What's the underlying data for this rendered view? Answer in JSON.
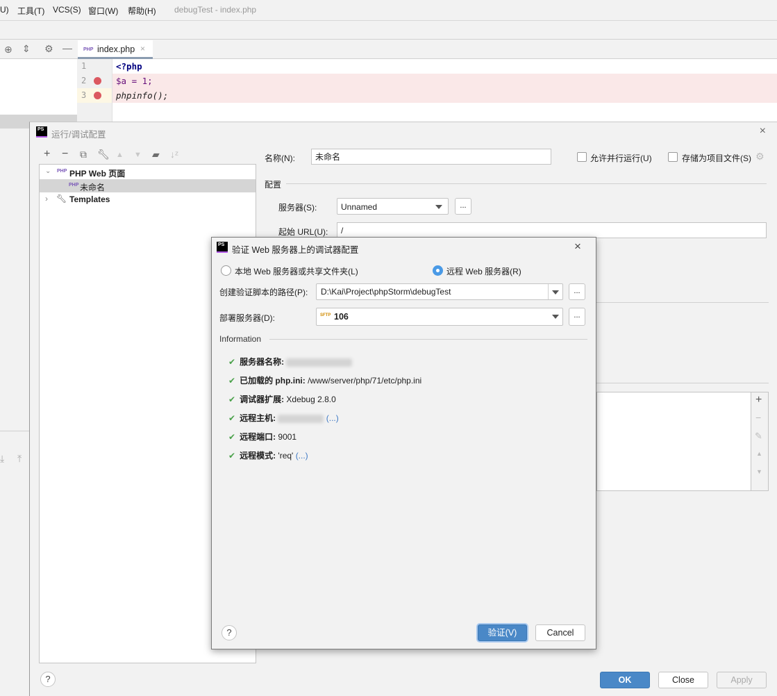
{
  "menu": {
    "items": [
      "U)",
      "工具(T)",
      "VCS(S)",
      "窗口(W)",
      "帮助(H)"
    ],
    "window_title": "debugTest - index.php"
  },
  "editor": {
    "tab": "index.php",
    "lines": [
      {
        "num": "1",
        "code": "<?php",
        "breakpoint": false
      },
      {
        "num": "2",
        "code": "$a = 1;",
        "breakpoint": true
      },
      {
        "num": "3",
        "code": "phpinfo();",
        "breakpoint": true
      }
    ]
  },
  "run_config": {
    "title": "运行/调试配置",
    "tree": {
      "group": "PHP Web 页面",
      "item": "未命名",
      "templates": "Templates"
    },
    "name_label": "名称(N):",
    "name_value": "未命名",
    "allow_parallel": "允许并行运行(U)",
    "store_as_project": "存储为项目文件(S)",
    "config_section": "配置",
    "server_label": "服务器(S):",
    "server_value": "Unnamed",
    "url_label": "起始 URL(U):",
    "url_value": "/",
    "dots": "...",
    "ok": "OK",
    "close": "Close",
    "apply": "Apply",
    "help": "?"
  },
  "validate_dialog": {
    "title": "验证 Web 服务器上的调试器配置",
    "radio_local": "本地 Web 服务器或共享文件夹(L)",
    "radio_remote": "远程 Web 服务器(R)",
    "selected": "remote",
    "path_label": "创建验证脚本的路径(P):",
    "path_value": "D:\\Kai\\Project\\phpStorm\\debugTest",
    "deploy_label": "部署服务器(D):",
    "deploy_value": "106",
    "deploy_icon": "SFTP",
    "info_section": "Information",
    "info": {
      "server_name_label": "服务器名称:",
      "php_ini_label_a": "已加载的",
      "php_ini_label_b": "php.ini:",
      "php_ini_value": "/www/server/php/71/etc/php.ini",
      "debugger_label": "调试器扩展:",
      "debugger_value": "Xdebug 2.8.0",
      "remote_host_label": "远程主机:",
      "remote_host_link": "(...)",
      "remote_port_label": "远程端口:",
      "remote_port_value": "9001",
      "remote_mode_label": "远程模式:",
      "remote_mode_value": "'req'",
      "remote_mode_link": "(...)"
    },
    "validate": "验证(V)",
    "cancel": "Cancel",
    "help": "?"
  },
  "colors": {
    "accent": "#4a88c7",
    "check": "#4aa14a",
    "breakpoint": "#db5860",
    "breakpoint_line": "#fae8e8"
  }
}
